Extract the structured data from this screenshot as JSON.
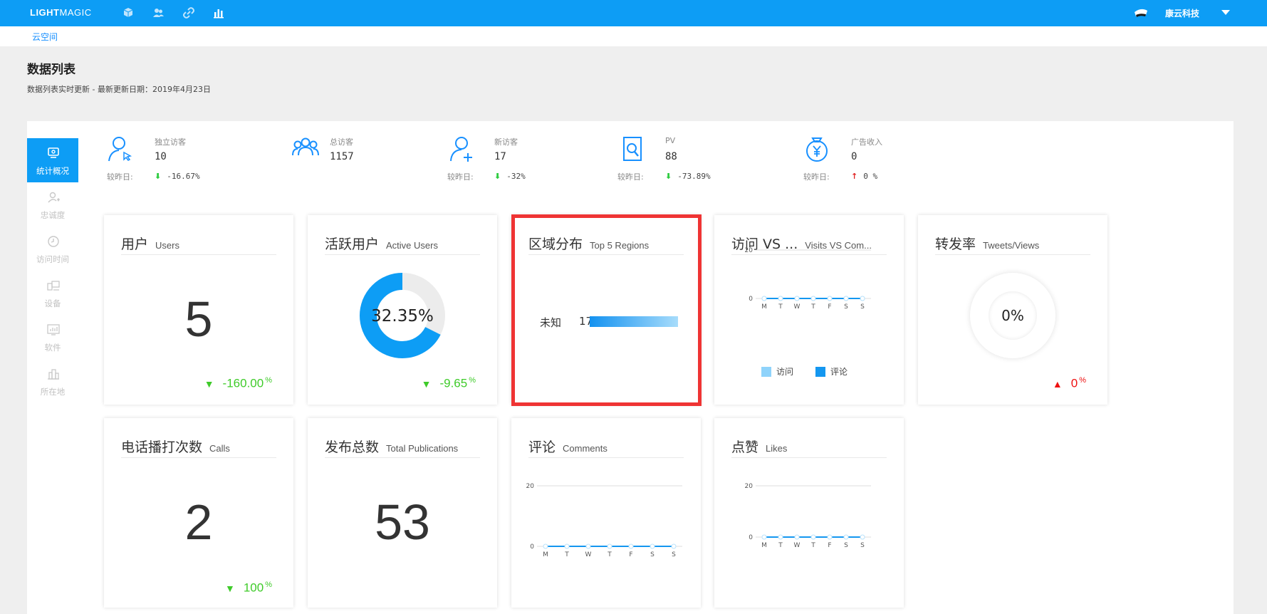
{
  "app": {
    "logo_bold": "LIGHT",
    "logo_light": "MAGIC",
    "company": "康云科技",
    "top_icons": [
      "cube-icon",
      "users-icon",
      "link-icon",
      "bar-chart-icon"
    ],
    "breadcrumb": "云空间"
  },
  "page": {
    "title": "数据列表",
    "subtitle": "数据列表实时更新  -  最新更新日期：2019年4月23日"
  },
  "sidebar": {
    "items": [
      {
        "label": "统计概况",
        "icon": "monitor-icon",
        "active": true
      },
      {
        "label": "忠诚度",
        "icon": "user-heart-icon",
        "active": false
      },
      {
        "label": "访问时间",
        "icon": "clock-icon",
        "active": false
      },
      {
        "label": "设备",
        "icon": "devices-icon",
        "active": false
      },
      {
        "label": "软件",
        "icon": "software-icon",
        "active": false
      },
      {
        "label": "所在地",
        "icon": "building-icon",
        "active": false
      }
    ]
  },
  "stats": [
    {
      "name": "独立访客",
      "value": "10",
      "compare_label": "较昨日:",
      "change": "-16.67%",
      "direction": "down",
      "icon": "user-cursor-icon"
    },
    {
      "name": "总访客",
      "value": "1157",
      "compare_label": "",
      "change": "",
      "direction": "",
      "icon": "group-icon"
    },
    {
      "name": "新访客",
      "value": "17",
      "compare_label": "较昨日:",
      "change": "-32%",
      "direction": "down",
      "icon": "user-add-icon"
    },
    {
      "name": "PV",
      "value": "88",
      "compare_label": "较昨日:",
      "change": "-73.89%",
      "direction": "down",
      "icon": "page-search-icon"
    },
    {
      "name": "广告收入",
      "value": "0",
      "compare_label": "较昨日:",
      "change": "0 %",
      "direction": "up",
      "icon": "money-bag-icon"
    }
  ],
  "cards": {
    "users": {
      "cn": "用户",
      "en": "Users",
      "value": "5",
      "trend": "-160.00",
      "unit": "%"
    },
    "active_users": {
      "cn": "活跃用户",
      "en": "Active Users",
      "percent_label": "32.35%",
      "percent": 32.35,
      "trend": "-9.65",
      "unit": "%"
    },
    "regions": {
      "cn": "区域分布",
      "en": "Top 5 Regions",
      "region": "未知",
      "count": "17"
    },
    "visits": {
      "cn": "访问 VS ...",
      "en": "Visits VS Com...",
      "legend_a": "访问",
      "legend_b": "评论"
    },
    "tweets": {
      "cn": "转发率",
      "en": "Tweets/Views",
      "percent_label": "0%",
      "trend": "0",
      "unit": "%"
    },
    "calls": {
      "cn": "电话播打次数",
      "en": "Calls",
      "value": "2",
      "trend": "100",
      "unit": "%"
    },
    "publications": {
      "cn": "发布总数",
      "en": "Total Publications",
      "value": "53"
    },
    "comments": {
      "cn": "评论",
      "en": "Comments"
    },
    "likes": {
      "cn": "点赞",
      "en": "Likes"
    }
  },
  "chart_data": [
    {
      "type": "line",
      "categories": [
        "M",
        "T",
        "W",
        "T",
        "F",
        "S",
        "S"
      ],
      "series": [
        {
          "name": "访问",
          "values": [
            0,
            0,
            0,
            0,
            0,
            0,
            0
          ]
        },
        {
          "name": "评论",
          "values": [
            0,
            0,
            0,
            0,
            0,
            0,
            0
          ]
        }
      ],
      "yticks": [
        "20",
        "0"
      ],
      "ylim": [
        0,
        20
      ]
    },
    {
      "type": "line",
      "categories": [
        "M",
        "T",
        "W",
        "T",
        "F",
        "S",
        "S"
      ],
      "series": [
        {
          "values": [
            0,
            0,
            0,
            0,
            0,
            0,
            0
          ]
        }
      ],
      "yticks": [
        "20",
        "0"
      ],
      "ylim": [
        0,
        20
      ]
    },
    {
      "type": "line",
      "categories": [
        "M",
        "T",
        "W",
        "T",
        "F",
        "S",
        "S"
      ],
      "series": [
        {
          "values": [
            0,
            0,
            0,
            0,
            0,
            0,
            0
          ]
        }
      ],
      "yticks": [
        "20",
        "0"
      ],
      "ylim": [
        0,
        20
      ]
    },
    {
      "type": "bar",
      "categories": [
        "未知"
      ],
      "values": [
        17
      ]
    }
  ],
  "colors": {
    "primary": "#0d9df5",
    "down": "#3fcb2a",
    "up": "#ee1111",
    "highlight": "#ef3434",
    "legend_a": "#8fd3fb",
    "legend_b": "#1497f0"
  }
}
